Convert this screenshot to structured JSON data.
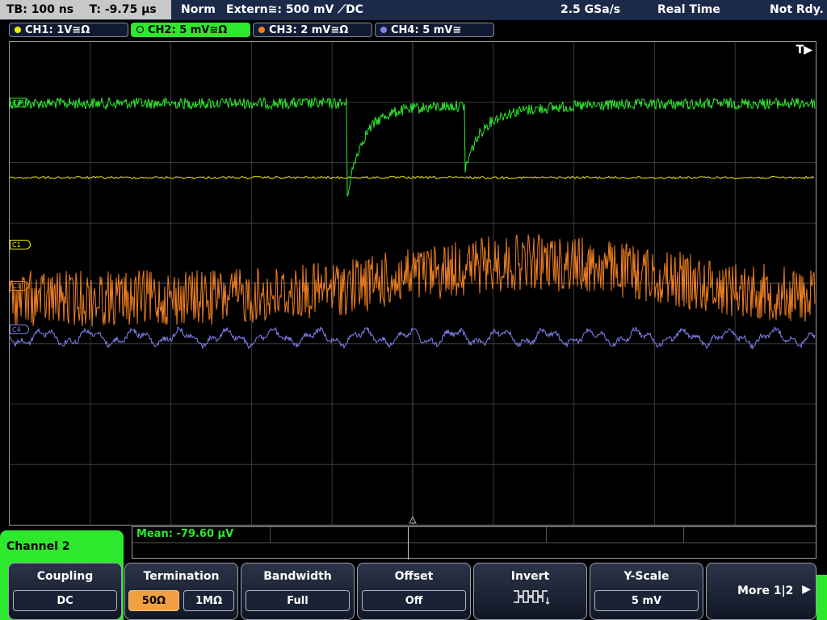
{
  "topbar": {
    "timebase": "TB: 100 ns",
    "trigger_time": "T: -9.75 µs",
    "mode": "Norm",
    "trigger_source": "Extern≅: 500 mV ⟋DC",
    "sample_rate": "2.5 GSa/s",
    "acq_mode": "Real Time",
    "status": "Not Rdy."
  },
  "channels": [
    {
      "label": "CH1: 1V≅Ω",
      "color": "#f5f000"
    },
    {
      "label": "CH2: 5 mV≅Ω",
      "color": "#2ee82e"
    },
    {
      "label": "CH3: 2 mV≅Ω",
      "color": "#f08020"
    },
    {
      "label": "CH4: 5 mV≅",
      "color": "#8080f0"
    }
  ],
  "markers": {
    "c1": "C1",
    "c2": "C2",
    "c3": "C3",
    "c4": "C4",
    "trigger": "T▶"
  },
  "measurement": {
    "mean": "Mean: -79.60 µV"
  },
  "panel": {
    "channel_label": "Channel 2"
  },
  "softkeys": {
    "coupling": {
      "title": "Coupling",
      "value": "DC"
    },
    "termination": {
      "title": "Termination",
      "opt1": "50Ω",
      "opt2": "1MΩ"
    },
    "bandwidth": {
      "title": "Bandwidth",
      "value": "Full"
    },
    "offset": {
      "title": "Offset",
      "value": "Off"
    },
    "invert": {
      "title": "Invert",
      "icon": "invert-waveform-icon"
    },
    "yscale": {
      "title": "Y-Scale",
      "value": "5 mV"
    },
    "more": {
      "label": "More 1|2"
    }
  }
}
